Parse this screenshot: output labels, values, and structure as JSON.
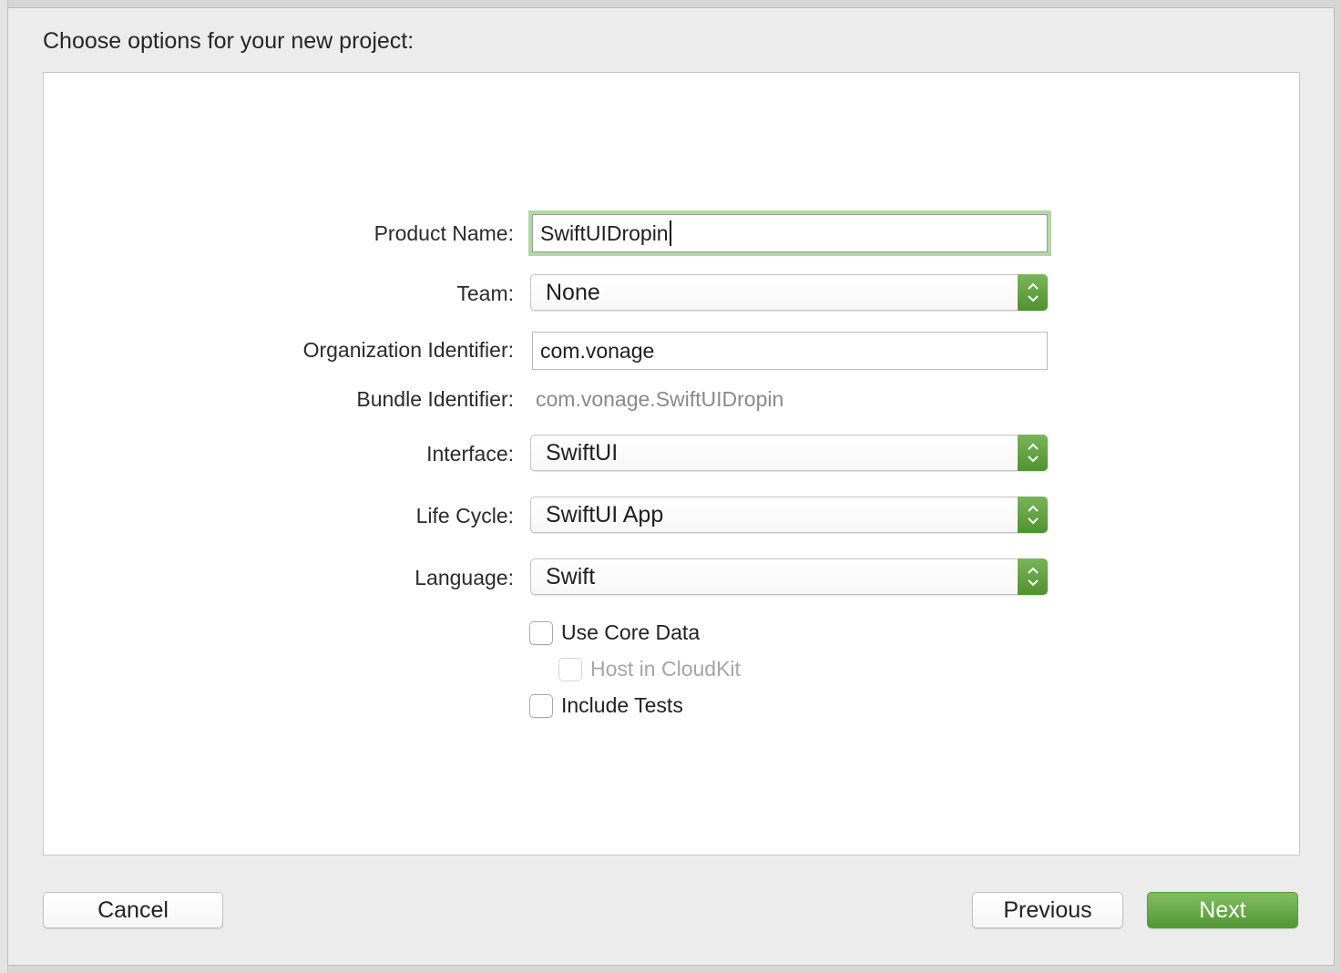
{
  "dialog": {
    "title": "Choose options for your new project:"
  },
  "form": {
    "product_name": {
      "label": "Product Name:",
      "value": "SwiftUIDropin"
    },
    "team": {
      "label": "Team:",
      "value": "None"
    },
    "organization_identifier": {
      "label": "Organization Identifier:",
      "value": "com.vonage"
    },
    "bundle_identifier": {
      "label": "Bundle Identifier:",
      "value": "com.vonage.SwiftUIDropin"
    },
    "interface": {
      "label": "Interface:",
      "value": "SwiftUI"
    },
    "life_cycle": {
      "label": "Life Cycle:",
      "value": "SwiftUI App"
    },
    "language": {
      "label": "Language:",
      "value": "Swift"
    },
    "use_core_data": {
      "label": "Use Core Data",
      "checked": false
    },
    "host_in_cloudkit": {
      "label": "Host in CloudKit",
      "checked": false,
      "enabled": false
    },
    "include_tests": {
      "label": "Include Tests",
      "checked": false
    }
  },
  "buttons": {
    "cancel": "Cancel",
    "previous": "Previous",
    "next": "Next"
  },
  "icons": {
    "popup_arrows": "chevron-up-down-icon"
  },
  "colors": {
    "accent": "#5e9f3e",
    "focus_ring": "#b5d6a5"
  }
}
